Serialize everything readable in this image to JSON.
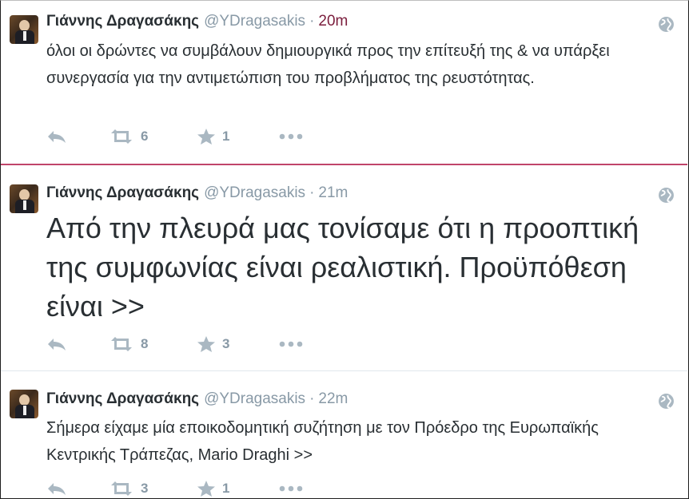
{
  "tweets": [
    {
      "name": "Γιάννης Δραγασάκης",
      "handle": "@YDragasakis",
      "separator": "·",
      "time": "20m",
      "text": "όλοι οι δρώντες να συμβάλουν δημιουργικά προς την επίτευξή της & να υπάρξει συνεργασία για την αντιμετώπιση του προβλήματος της ρευστότητας.",
      "retweets": "6",
      "favorites": "1"
    },
    {
      "name": "Γιάννης Δραγασάκης",
      "handle": "@YDragasakis",
      "separator": "·",
      "time": "21m",
      "text": "Από την πλευρά μας τονίσαμε ότι η προοπτική της συμφωνίας είναι ρεαλιστική. Προϋπόθεση είναι  >>",
      "retweets": "8",
      "favorites": "3"
    },
    {
      "name": "Γιάννης Δραγασάκης",
      "handle": "@YDragasakis",
      "separator": "·",
      "time": "22m",
      "text": "Σήμερα είχαμε μία εποικοδομητική συζήτηση με τον Πρόεδρο της Ευρωπαϊκής Κεντρικής Τράπεζας, Mario Draghi >>",
      "retweets": "3",
      "favorites": "1"
    }
  ]
}
